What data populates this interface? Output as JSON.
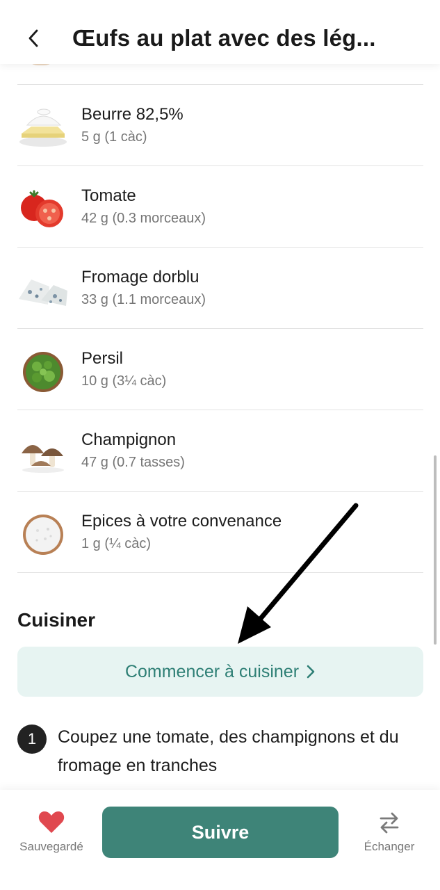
{
  "header": {
    "title": "Œufs au plat avec des lég...",
    "back_icon": "chevron-left-icon"
  },
  "ingredients": [
    {
      "name": "Beurre 82,5%",
      "quantity": "5 g (1 càc)",
      "icon": "butter-image"
    },
    {
      "name": "Tomate",
      "quantity": "42 g (0.3 morceaux)",
      "icon": "tomato-image"
    },
    {
      "name": "Fromage dorblu",
      "quantity": "33 g (1.1 morceaux)",
      "icon": "blue-cheese-image"
    },
    {
      "name": "Persil",
      "quantity": "10 g (3¼ càc)",
      "icon": "parsley-image"
    },
    {
      "name": "Champignon",
      "quantity": "47 g (0.7 tasses)",
      "icon": "mushroom-image"
    },
    {
      "name": "Epices à votre convenance",
      "quantity": "1 g (¼ càc)",
      "icon": "salt-image"
    }
  ],
  "cook_section": {
    "title": "Cuisiner",
    "start_button": "Commencer à cuisiner"
  },
  "steps": [
    {
      "number": "1",
      "text": "Coupez une tomate, des champignons et du fromage en tranches"
    }
  ],
  "bottom_bar": {
    "saved_label": "Sauvegardé",
    "follow_label": "Suivre",
    "swap_label": "Échanger"
  },
  "colors": {
    "accent": "#3e8478",
    "accent_light": "#e7f4f2",
    "accent_text": "#2e7f75",
    "heart": "#e0484f"
  }
}
